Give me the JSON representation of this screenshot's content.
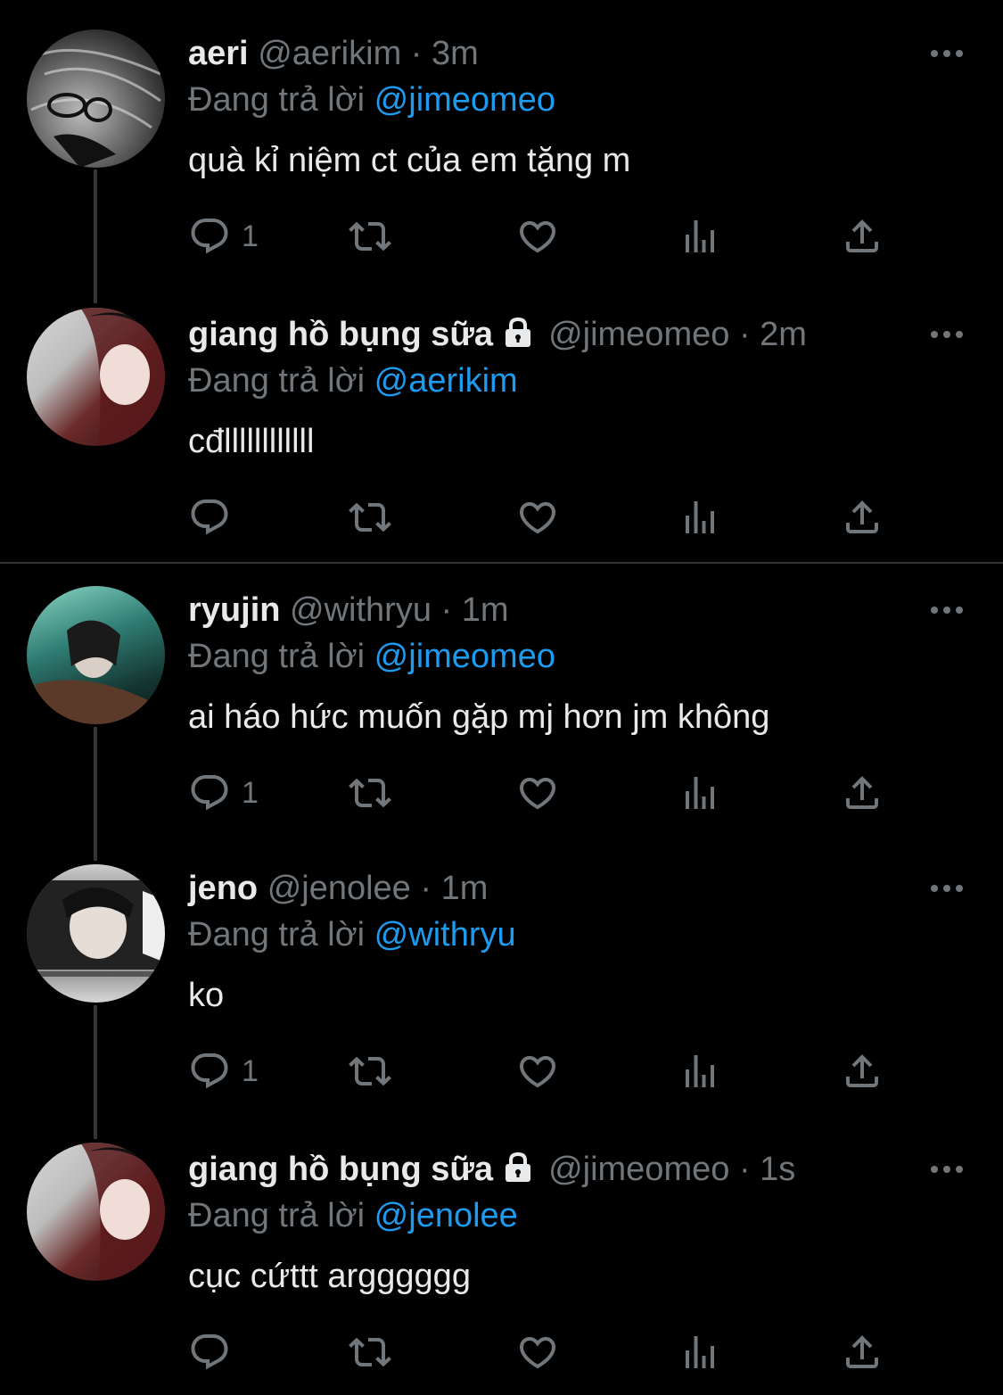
{
  "colors": {
    "background": "#000000",
    "text": "#e7e9ea",
    "muted": "#71767b",
    "mention": "#1d9bf0",
    "thread_line": "#333639"
  },
  "tweets": [
    {
      "name": "aeri",
      "handle": "@aerikim",
      "time": "· 3m",
      "replying_label": "Đang trả lời",
      "replying_to": "@jimeomeo",
      "text": "quà kỉ niệm ct của em tặng m",
      "reply_count": "1",
      "locked": false
    },
    {
      "name": "giang hồ bụng sữa",
      "handle": "@jimeomeo",
      "time": "· 2m",
      "replying_label": "Đang trả lời",
      "replying_to": "@aerikim",
      "text": "cđllllllllllll",
      "reply_count": "",
      "locked": true
    },
    {
      "name": "ryujin",
      "handle": "@withryu",
      "time": "· 1m",
      "replying_label": "Đang trả lời",
      "replying_to": "@jimeomeo",
      "text": "ai háo hức muốn gặp mj hơn jm không",
      "reply_count": "1",
      "locked": false
    },
    {
      "name": "jeno",
      "handle": "@jenolee",
      "time": "· 1m",
      "replying_label": "Đang trả lời",
      "replying_to": "@withryu",
      "text": "ko",
      "reply_count": "1",
      "locked": false
    },
    {
      "name": "giang hồ bụng sữa",
      "handle": "@jimeomeo",
      "time": "· 1s",
      "replying_label": "Đang trả lời",
      "replying_to": "@jenolee",
      "text": "cục cứttt argggggg",
      "reply_count": "",
      "locked": true
    }
  ]
}
